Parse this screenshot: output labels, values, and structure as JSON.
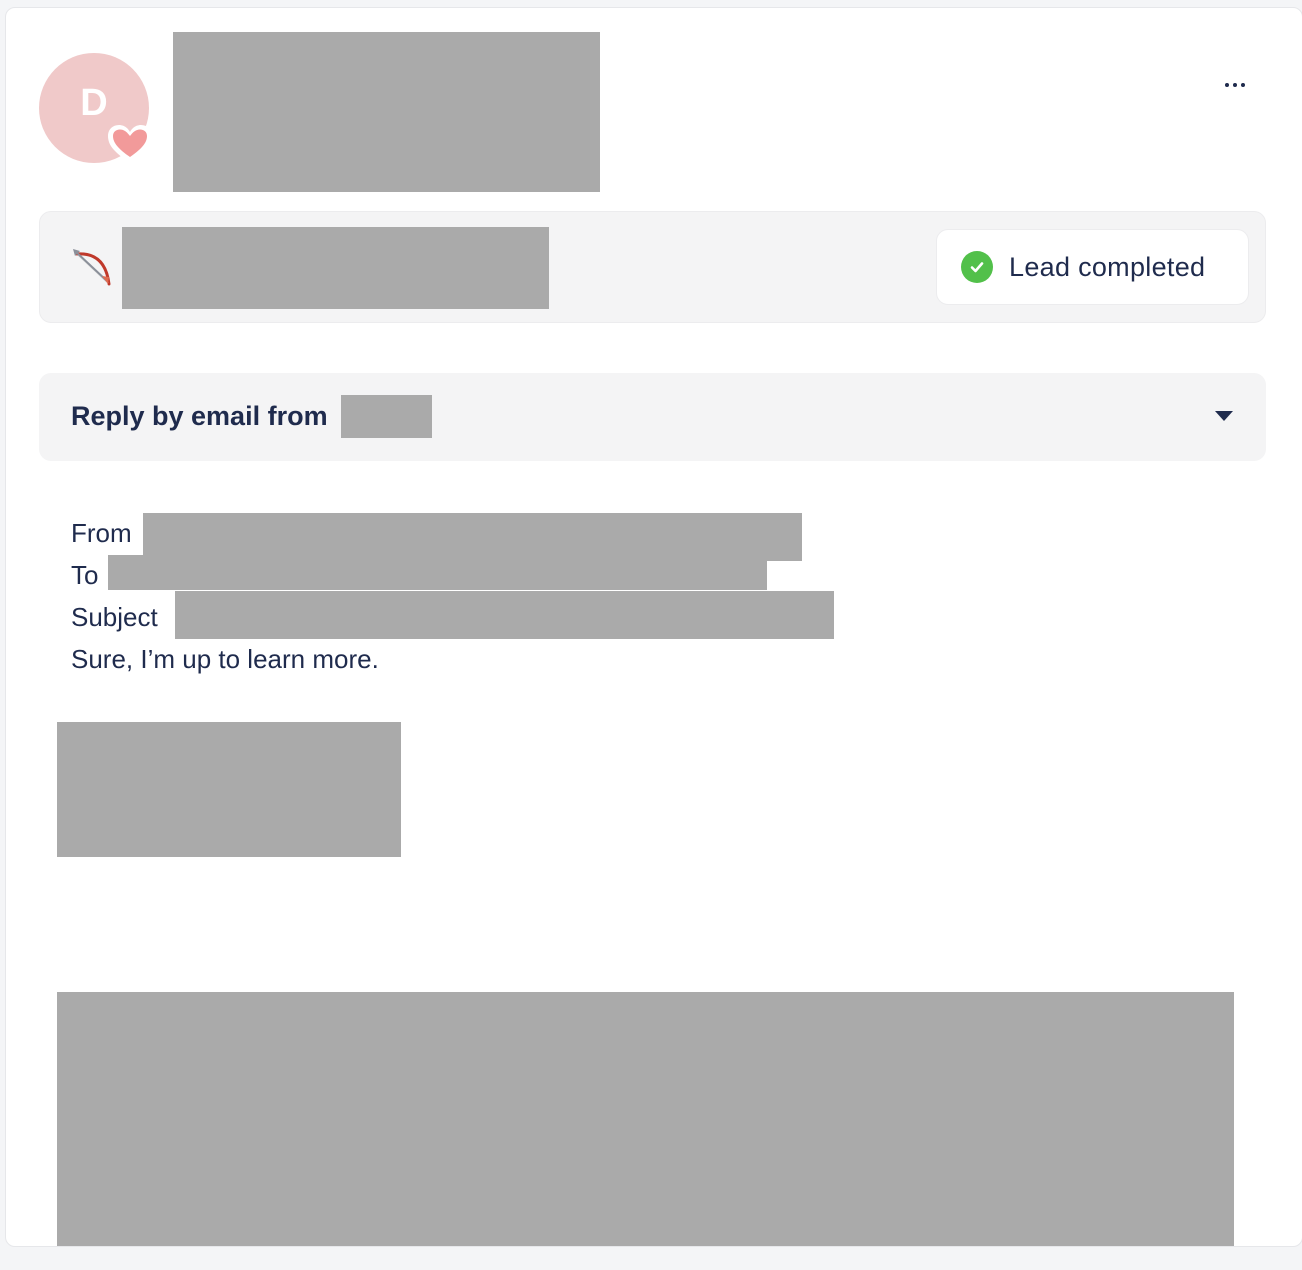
{
  "contact": {
    "avatar_initial": "D",
    "avatar_color": "#f0c9c9",
    "badge_icon": "heart-icon"
  },
  "header": {
    "more_icon": "more-horizontal-icon"
  },
  "lead": {
    "campaign_icon": "bow-and-arrow-icon",
    "status_label": "Lead completed",
    "status_icon": "check-circle-icon",
    "status_color": "#52c04a"
  },
  "reply": {
    "title": "Reply by email from",
    "toggle_icon": "caret-down-icon",
    "from_label": "From",
    "to_label": "To",
    "subject_label": "Subject",
    "body": "Sure, I’m up to learn more."
  },
  "colors": {
    "text": "#1f2b4d",
    "panel_bg": "#f4f4f5",
    "redaction": "#aaaaaa"
  }
}
